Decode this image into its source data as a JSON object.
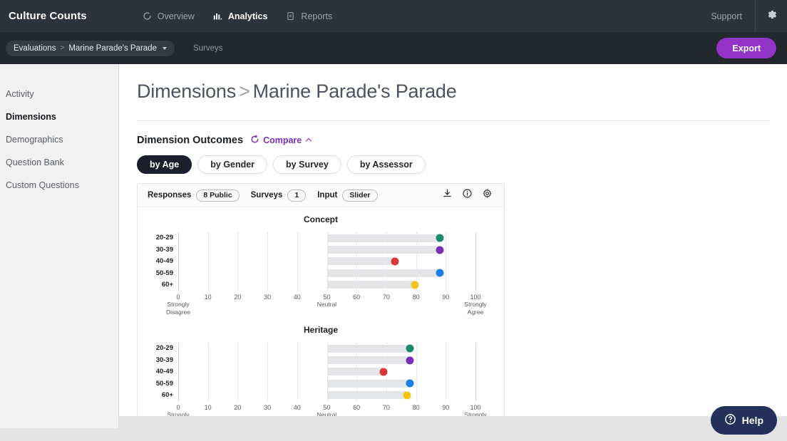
{
  "topnav": {
    "brand": "Culture Counts",
    "items": [
      {
        "label": "Overview",
        "icon": "circle-refresh-icon",
        "active": false
      },
      {
        "label": "Analytics",
        "icon": "bar-chart-icon",
        "active": true
      },
      {
        "label": "Reports",
        "icon": "document-icon",
        "active": false
      }
    ],
    "support_label": "Support",
    "settings_icon": "gear-icon"
  },
  "subnav": {
    "breadcrumb_root": "Evaluations",
    "breadcrumb_sep": ">",
    "breadcrumb_current": "Marine Parade's Parade",
    "surveys_label": "Surveys",
    "export_label": "Export",
    "export_color": "#9333c8"
  },
  "sidebar": {
    "items": [
      {
        "label": "Activity",
        "active": false
      },
      {
        "label": "Dimensions",
        "active": true
      },
      {
        "label": "Demographics",
        "active": false
      },
      {
        "label": "Question Bank",
        "active": false
      },
      {
        "label": "Custom Questions",
        "active": false
      }
    ]
  },
  "page": {
    "title_primary": "Dimensions",
    "title_sep": ">",
    "title_secondary": "Marine Parade's Parade",
    "section_title": "Dimension Outcomes",
    "compare_label": "Compare",
    "compare_color": "#7b2fb5",
    "tabs": [
      {
        "label": "by Age",
        "active": true
      },
      {
        "label": "by Gender",
        "active": false
      },
      {
        "label": "by Survey",
        "active": false
      },
      {
        "label": "by Assessor",
        "active": false
      }
    ]
  },
  "card": {
    "meta": [
      {
        "label": "Responses",
        "value": "8 Public"
      },
      {
        "label": "Surveys",
        "value": "1"
      },
      {
        "label": "Input",
        "value": "Slider"
      }
    ],
    "actions": [
      {
        "icon": "download-icon",
        "name": "download-button"
      },
      {
        "icon": "info-icon",
        "name": "info-button"
      },
      {
        "icon": "gear-icon",
        "name": "chart-settings-button"
      }
    ]
  },
  "chart_data": [
    {
      "type": "bar",
      "title": "Concept",
      "categories": [
        "20-29",
        "30-39",
        "40-49",
        "50-59",
        "60+"
      ],
      "values": [
        88,
        88,
        73,
        88,
        79.5
      ],
      "baseline": 50,
      "xlabel": "",
      "ylabel": "",
      "xlim": [
        0,
        100
      ],
      "xticks": [
        0,
        10,
        20,
        30,
        40,
        50,
        60,
        70,
        80,
        90,
        100
      ],
      "xtick_sublabels": {
        "0": "Strongly\nDisagree",
        "50": "Neutral",
        "100": "Strongly\nAgree"
      },
      "grid": true,
      "colors": [
        "#1a8a6e",
        "#7b2fb5",
        "#d93939",
        "#1a7fe8",
        "#f5c518"
      ],
      "bar_color": "#e4e5e9"
    },
    {
      "type": "bar",
      "title": "Heritage",
      "categories": [
        "20-29",
        "30-39",
        "40-49",
        "50-59",
        "60+"
      ],
      "values": [
        78,
        78,
        69,
        78,
        77
      ],
      "baseline": 50,
      "xlabel": "",
      "ylabel": "",
      "xlim": [
        0,
        100
      ],
      "xticks": [
        0,
        10,
        20,
        30,
        40,
        50,
        60,
        70,
        80,
        90,
        100
      ],
      "xtick_sublabels": {
        "0": "Strongly\nDisagree",
        "50": "Neutral",
        "100": "Strongly\nAgree"
      },
      "grid": true,
      "colors": [
        "#1a8a6e",
        "#7b2fb5",
        "#d93939",
        "#1a7fe8",
        "#f5c518"
      ],
      "bar_color": "#e4e5e9"
    }
  ],
  "help": {
    "label": "Help",
    "icon": "question-circle-icon",
    "color": "#243158"
  }
}
